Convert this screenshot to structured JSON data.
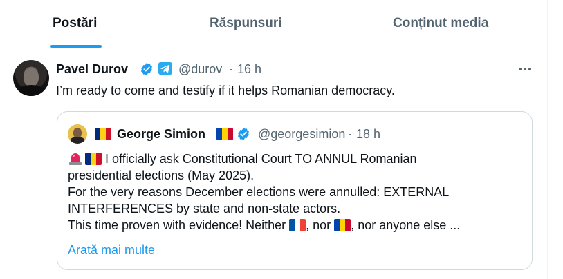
{
  "tabs": {
    "posts": "Postări",
    "replies": "Răspunsuri",
    "media": "Conținut media"
  },
  "post": {
    "author_name": "Pavel Durov",
    "handle": "@durov",
    "separator": "·",
    "time": "16 h",
    "text": "I’m ready to come and testify if it helps Romanian democracy."
  },
  "quote": {
    "author_name": "George Simion",
    "handle": "@georgesimion",
    "separator": "·",
    "time": "18 h",
    "line1": "I officially ask Constitutional Court TO ANNUL Romanian",
    "line2": "presidential elections (May 2025).",
    "line3": "For the very reasons December elections were annulled: EXTERNAL",
    "line4": "INTERFERENCES by state and non-state actors.",
    "line5a": "This time proven with evidence! Neither",
    "line5b": ", nor",
    "line5c": ", nor anyone else ...",
    "show_more": "Arată mai multe"
  },
  "colors": {
    "accent": "#1d9bf0",
    "verified": "#1d9bf0",
    "telegram": "#2aabee",
    "muted": "#536471",
    "border": "#cfd9de"
  },
  "icons": {
    "verified": "verified-badge-icon",
    "telegram": "telegram-icon",
    "more": "more-horizontal-icon",
    "siren": "police-light-emoji",
    "flag_ro": "romania-flag-emoji",
    "flag_md": "moldova-flag-emoji",
    "flag_fr": "france-flag-emoji"
  }
}
